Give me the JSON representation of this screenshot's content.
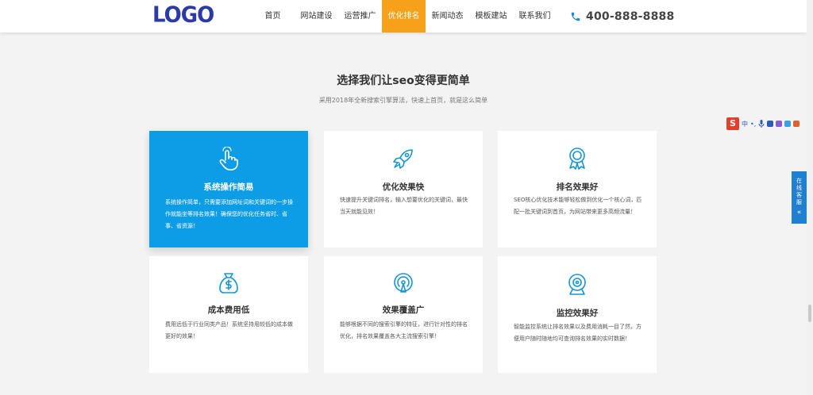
{
  "header": {
    "logo": "LOGO",
    "nav": [
      {
        "label": "首页",
        "active": false
      },
      {
        "label": "网站建设",
        "active": false
      },
      {
        "label": "运营推广",
        "active": false
      },
      {
        "label": "优化排名",
        "active": true
      },
      {
        "label": "新闻动态",
        "active": false
      },
      {
        "label": "模板建站",
        "active": false
      },
      {
        "label": "联系我们",
        "active": false
      }
    ],
    "phone": "400-888-8888"
  },
  "section": {
    "title": "选择我们让seo变得更简单",
    "subtitle": "采用2018年全新搜索引擎算法，快速上首页，就是这么简单"
  },
  "cards": [
    {
      "title": "系统操作简易",
      "desc": "系统操作简单，只需要添加网址词和关键词的一步操作就能坐等排名效果！确保您的优化任务省时、省事、省资源！",
      "icon": "hand-pointer-icon",
      "active": true
    },
    {
      "title": "优化效果快",
      "desc": "快速提升关键词排名，输入想要优化的关键词，最快当天就能见效！",
      "icon": "rocket-icon",
      "active": false
    },
    {
      "title": "排名效果好",
      "desc": "SEO核心优化技术能够轻松做到优化一个核心词，匹配一批关键词到首页，为网站带来更多高频流量！",
      "icon": "award-ribbon-icon",
      "active": false
    },
    {
      "title": "成本费用低",
      "desc": "费用远低于行业同类产品！系统坚持用较低的成本做更好的效果！",
      "icon": "money-bag-icon",
      "active": false
    },
    {
      "title": "效果覆盖广",
      "desc": "能够根据不同的搜索引擎的特征，进行针对性的排名优化，排名效果覆盖各大主流搜索引擎！",
      "icon": "broadcast-icon",
      "active": false
    },
    {
      "title": "监控效果好",
      "desc": "智能监控系统让排名效果以及费用消耗一目了然，方便用户随时随地均可查询排名效果的实时数据！",
      "icon": "webcam-icon",
      "active": false
    }
  ],
  "ime": {
    "logo": "S",
    "lang": "中",
    "punct": "•,"
  },
  "service": {
    "label": "在线客服",
    "arrow": "«"
  },
  "colors": {
    "accent": "#0c9de6",
    "nav_active": "#f7a019",
    "logo": "#2b3aa6"
  }
}
